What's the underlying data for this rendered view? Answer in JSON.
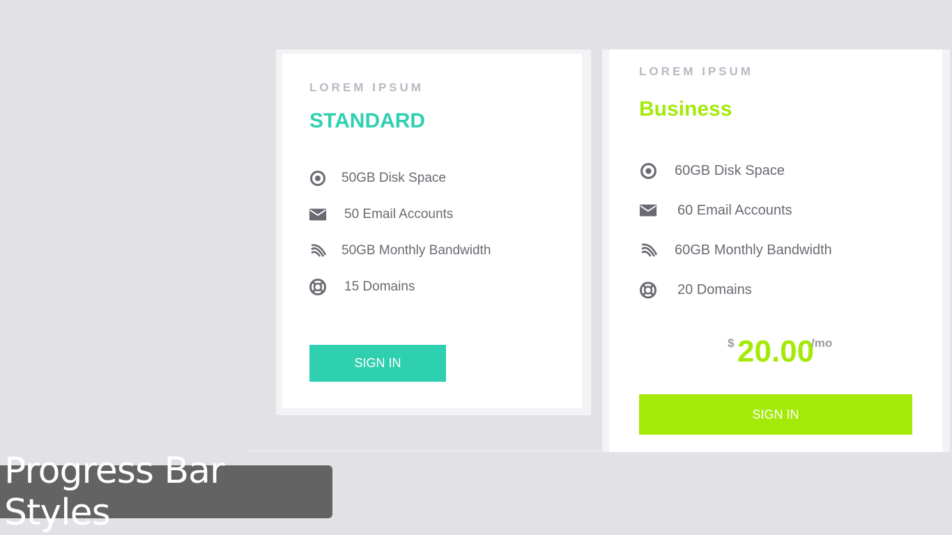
{
  "caption": "Progress Bar Styles",
  "standard": {
    "eyebrow": "LOREM IPSUM",
    "title": "STANDARD",
    "accent": "#2fd0b0",
    "features": [
      {
        "icon": "target-icon",
        "label": "50GB Disk Space"
      },
      {
        "icon": "envelope-icon",
        "label": "50 Email Accounts"
      },
      {
        "icon": "bandwidth-icon",
        "label": "50GB Monthly Bandwidth"
      },
      {
        "icon": "lifebuoy-icon",
        "label": "15 Domains"
      }
    ],
    "button_label": "SIGN IN"
  },
  "business": {
    "eyebrow": "LOREM IPSUM",
    "title": "Business",
    "accent": "#a3ea08",
    "features": [
      {
        "icon": "target-icon",
        "label": "60GB Disk Space"
      },
      {
        "icon": "envelope-icon",
        "label": "60 Email Accounts"
      },
      {
        "icon": "bandwidth-icon",
        "label": "60GB Monthly Bandwidth"
      },
      {
        "icon": "lifebuoy-icon",
        "label": "20 Domains"
      }
    ],
    "price": {
      "currency": "$",
      "amount": "20.00",
      "period": "/mo"
    },
    "button_label": "SIGN IN"
  }
}
